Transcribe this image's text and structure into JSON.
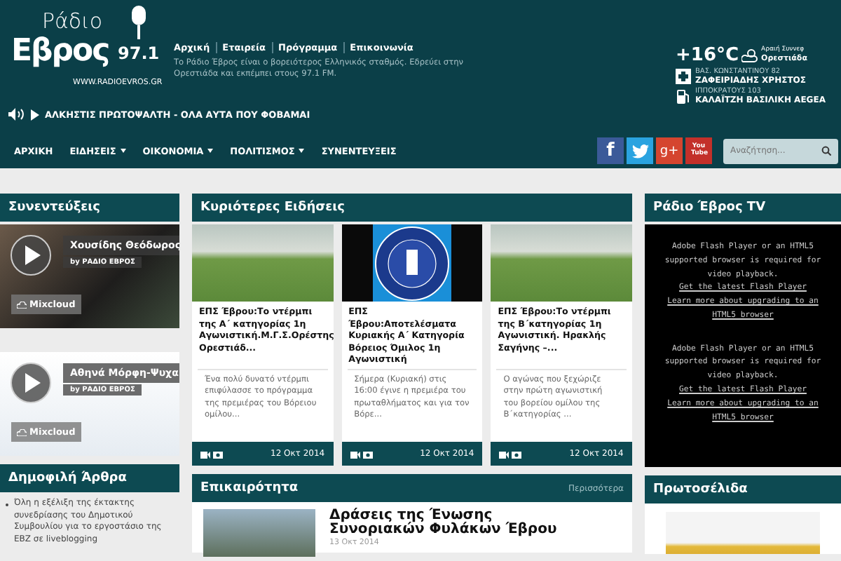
{
  "header": {
    "logo": {
      "top": "Ράδιο",
      "main": "Εβρος",
      "freq": "97.1",
      "url": "WWW.RADIOEVROS.GR"
    },
    "links": [
      "Αρχική",
      "Εταιρεία",
      "Πρόγραμμα",
      "Επικοινωνία"
    ],
    "description": "Το Ράδιο Έβρος είναι ο βορειότερος Ελληνικός σταθμός. Εδρεύει στην Ορεστιάδα και εκπέμπει στους 97.1 FM.",
    "now_playing": "ΑΛΚΗΣΤΙΣ ΠΡΩΤΟΨΑΛΤΗ - ΟΛΑ ΑΥΤΑ ΠΟΥ ΦΟΒΑΜΑΙ",
    "weather": {
      "temp": "+16°C",
      "condition": "Αραιή Συννεφ",
      "city": "Ορεστιάδα"
    },
    "services": [
      {
        "kind": "pharmacy",
        "address": "ΒΑΣ. ΚΩΝΣΤΑΝΤΙΝΟΥ 82",
        "name": "ΖΑΦΕΙΡΙΑΔΗΣ ΧΡΗΣΤΟΣ"
      },
      {
        "kind": "fuel",
        "address": "ΙΠΠΟΚΡΑΤΟΥΣ 103",
        "name": "ΚΑΛΑΪΤΖΗ ΒΑΣΙΛΙΚΗ AEGEA"
      }
    ]
  },
  "nav": {
    "items": [
      {
        "label": "ΑΡΧΙΚΗ",
        "has_menu": false
      },
      {
        "label": "ΕΙΔΗΣΕΙΣ",
        "has_menu": true
      },
      {
        "label": "ΟΙΚΟΝΟΜΙΑ",
        "has_menu": true
      },
      {
        "label": "ΠΟΛΙΤΙΣΜΟΣ",
        "has_menu": true
      },
      {
        "label": "ΣΥΝΕΝΤΕΥΞΕΙΣ",
        "has_menu": false
      }
    ],
    "social": [
      {
        "kind": "facebook",
        "label": "f"
      },
      {
        "kind": "twitter"
      },
      {
        "kind": "google",
        "label": "g+"
      },
      {
        "kind": "youtube",
        "label": "You Tube"
      }
    ],
    "search": {
      "placeholder": "Αναζήτηση..."
    }
  },
  "interviews": {
    "title": "Συνεντεύξεις",
    "players": [
      {
        "title": "Χουσίδης Θεόδωρος",
        "by": "by ΡΑΔΙΟ ΕΒΡΟΣ",
        "badge": "Mixcloud"
      },
      {
        "title": "Αθηνά Μόρφη-Ψυχα",
        "by": "by ΡΑΔΙΟ ΕΒΡΟΣ",
        "badge": "Mixcloud"
      }
    ]
  },
  "popular": {
    "title": "Δημοφιλή Άρθρα",
    "items": [
      "Όλη η εξέλιξη της έκτακτης συνεδρίασης του Δημοτικού Συμβουλίου για το εργοστάσιο της ΕΒΖ σε liveblogging"
    ]
  },
  "main_news": {
    "title": "Κυριότερες Ειδήσεις",
    "cards": [
      {
        "title": "ΕΠΣ Έβρου:Το ντέρμπι της Α΄ κατηγορίας 1η Αγωνιστική.Μ.Γ.Σ.Ορέστης Ορεστιάδ...",
        "excerpt": "Ένα πολύ δυνατό ντέρμπι επιφύλασσε το πρόγραμμα της πρεμιέρας του Βόρειου ομίλου...",
        "date": "12 Οκτ 2014"
      },
      {
        "title": "ΕΠΣ Έβρου:Αποτελέσματα Κυριακής Α΄ Κατηγορία Βόρειος Όμιλος 1η Αγωνιστική",
        "excerpt": "Σήμερα (Κυριακή) στις 16:00 έγινε η πρεμιέρα του πρωταθλήματος και για τον Βόρε...",
        "date": "12 Οκτ 2014"
      },
      {
        "title": "ΕΠΣ Έβρου:Το ντέρμπι της Β΄κατηγορίας 1η Αγωνιστική. Ηρακλής Σαγήνης –...",
        "excerpt": "Ο αγώνας που ξεχώριζε στην πρώτη αγωνιστική του βορείου ομίλου της Β΄κατηγορίας ...",
        "date": "12 Οκτ 2014"
      }
    ]
  },
  "current": {
    "title": "Επικαιρότητα",
    "more": "Περισσότερα",
    "article": {
      "title": "Δράσεις της Ένωσης Συνοριακών Φυλάκων Έβρου",
      "date": "13 Οκτ 2014"
    }
  },
  "tv": {
    "title": "Ράδιο Έβρος TV",
    "messages": [
      {
        "text": "Adobe Flash Player or an HTML5 supported browser is required for video playback.",
        "links": [
          "Get the latest Flash Player",
          "Learn more about upgrading to an HTML5 browser"
        ]
      },
      {
        "text": "Adobe Flash Player or an HTML5 supported browser is required for video playback.",
        "links": [
          "Get the latest Flash Player",
          "Learn more about upgrading to an HTML5 browser"
        ]
      }
    ]
  },
  "front_pages": {
    "title": "Πρωτοσέλιδα"
  }
}
